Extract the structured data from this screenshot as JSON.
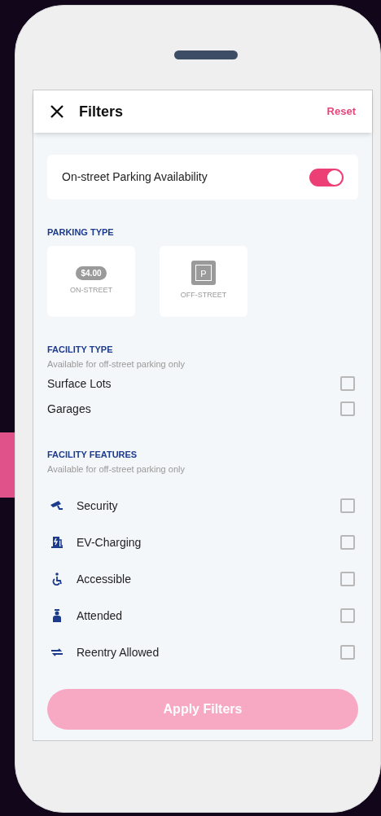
{
  "header": {
    "title": "Filters",
    "reset": "Reset"
  },
  "availability": {
    "label": "On-street Parking Availability",
    "on": true
  },
  "parking_type": {
    "heading": "PARKING TYPE",
    "options": [
      {
        "kind": "price",
        "badge": "$4.00",
        "label": "ON-STREET",
        "selected": false
      },
      {
        "kind": "garage",
        "badge": "P",
        "label": "OFF-STREET",
        "selected": false
      }
    ]
  },
  "facility_type": {
    "heading": "FACILITY TYPE",
    "note": "Available for off-street parking only",
    "items": [
      {
        "label": "Surface Lots",
        "checked": false
      },
      {
        "label": "Garages",
        "checked": false
      }
    ]
  },
  "facility_features": {
    "heading": "FACILITY FEATURES",
    "note": "Available for off-street parking only",
    "items": [
      {
        "kind": "security",
        "label": "Security",
        "checked": false
      },
      {
        "kind": "ev",
        "label": "EV-Charging",
        "checked": false
      },
      {
        "kind": "accessible",
        "label": "Accessible",
        "checked": false
      },
      {
        "kind": "attended",
        "label": "Attended",
        "checked": false
      },
      {
        "kind": "reentry",
        "label": "Reentry Allowed",
        "checked": false
      }
    ]
  },
  "apply_button": {
    "label": "Apply Filters",
    "disabled": true
  }
}
